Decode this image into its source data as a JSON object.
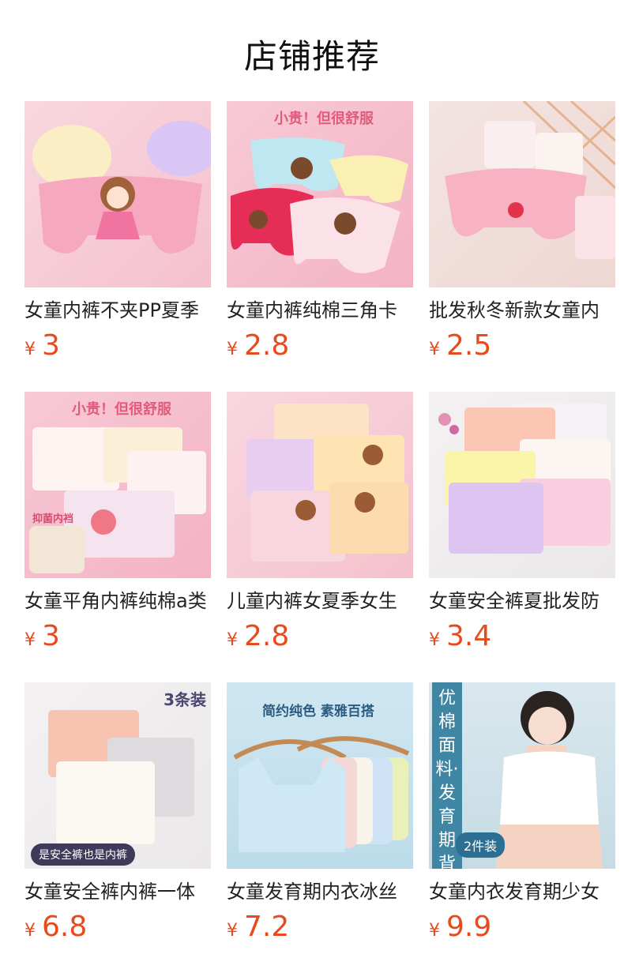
{
  "header": {
    "title": "店铺推荐"
  },
  "currency": "¥",
  "products": [
    {
      "title": "女童内裤不夹PP夏季",
      "price": "3",
      "thumb": "pink-princess-briefs"
    },
    {
      "title": "女童内裤纯棉三角卡",
      "price": "2.8",
      "thumb": "pink-yellow-briefs",
      "tag": "小贵！但很舒服"
    },
    {
      "title": "批发秋冬新款女童内",
      "price": "2.5",
      "thumb": "strawberry-briefs"
    },
    {
      "title": "女童平角内裤纯棉a类",
      "price": "3",
      "thumb": "boxer-briefs",
      "tag": "小贵！但很舒服",
      "tag2": "抑菌内裆"
    },
    {
      "title": "儿童内裤女夏季女生",
      "price": "2.8",
      "thumb": "pastel-boxers"
    },
    {
      "title": "女童安全裤夏批发防",
      "price": "3.4",
      "thumb": "safety-shorts"
    },
    {
      "title": "女童安全裤内裤一体",
      "price": "6.8",
      "thumb": "3-pack-shorts",
      "tag": "3条装",
      "badge": "是安全裤也是内裤"
    },
    {
      "title": "女童发育期内衣冰丝",
      "price": "7.2",
      "thumb": "vests-on-hangers",
      "tag": "简约纯色 素雅百搭"
    },
    {
      "title": "女童内衣发育期少女",
      "price": "9.9",
      "thumb": "girl-bra-model",
      "vertical": "优棉面料·发育期背心",
      "badge": "2件装"
    }
  ]
}
